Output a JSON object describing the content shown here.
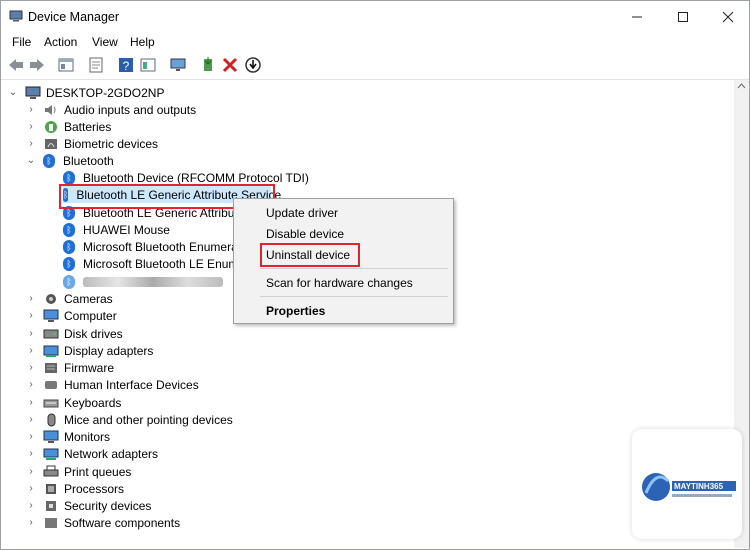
{
  "window": {
    "title": "Device Manager"
  },
  "menu": [
    "File",
    "Action",
    "View",
    "Help"
  ],
  "tree": {
    "root": "DESKTOP-2GDO2NP",
    "categories_top": [
      "Audio inputs and outputs",
      "Batteries",
      "Biometric devices",
      "Bluetooth"
    ],
    "bluetooth_children": [
      "Bluetooth Device (RFCOMM Protocol TDI)",
      "Bluetooth LE Generic Attribute Service",
      "Bluetooth LE Generic Attribute",
      "HUAWEI  Mouse",
      "Microsoft Bluetooth Enumerat",
      "Microsoft Bluetooth LE Enume"
    ],
    "categories_bottom": [
      "Cameras",
      "Computer",
      "Disk drives",
      "Display adapters",
      "Firmware",
      "Human Interface Devices",
      "Keyboards",
      "Mice and other pointing devices",
      "Monitors",
      "Network adapters",
      "Print queues",
      "Processors",
      "Security devices",
      "Software components"
    ]
  },
  "context_menu": {
    "update": "Update driver",
    "disable": "Disable device",
    "uninstall": "Uninstall device",
    "scan": "Scan for hardware changes",
    "properties": "Properties"
  },
  "colors": {
    "highlight_box": "#e0252f",
    "selection": "#cce8ff",
    "bluetooth": "#1e6fd9"
  }
}
